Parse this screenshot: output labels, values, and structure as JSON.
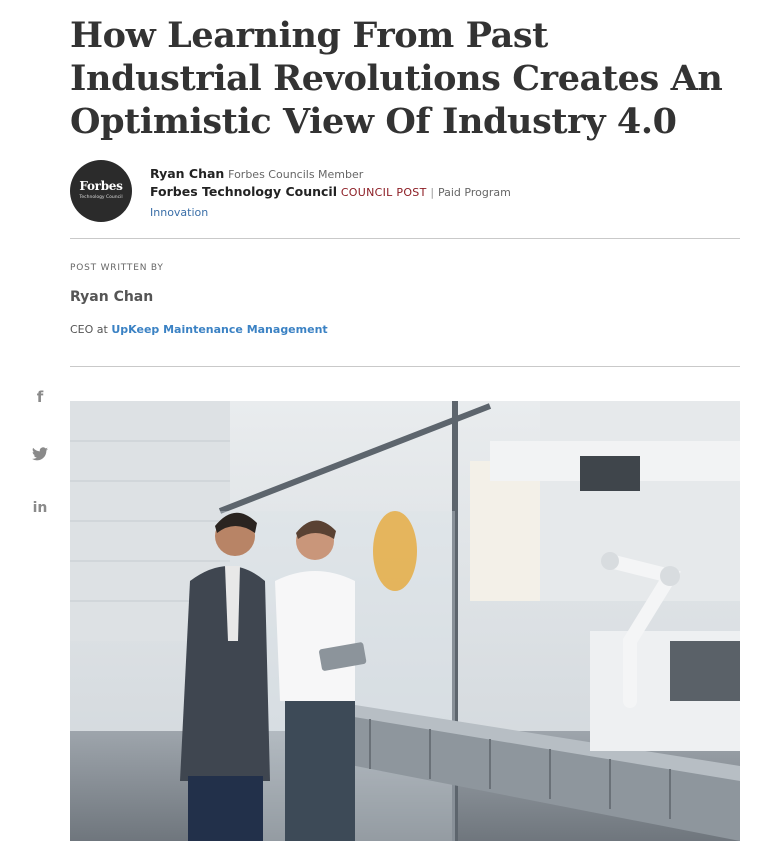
{
  "article": {
    "title": "How Learning From Past Industrial Revolutions Creates An Optimistic View Of Industry 4.0"
  },
  "byline": {
    "logo_text": "Forbes",
    "logo_subtext": "Technology Council",
    "author": "Ryan Chan",
    "member_label": "Forbes Councils Member",
    "council": "Forbes Technology Council",
    "post_tag": "COUNCIL POST",
    "separator": "|",
    "paid_label": "Paid Program",
    "topic": "Innovation"
  },
  "written_by": {
    "label": "POST WRITTEN BY",
    "name": "Ryan Chan",
    "role_prefix": "CEO at",
    "company": "UpKeep Maintenance Management"
  },
  "social": {
    "facebook_icon": "f",
    "twitter_icon": "twitter-bird",
    "linkedin_icon": "in"
  },
  "hero_image": {
    "subject": "two-men-with-tablet-beside-robotic-assembly-line"
  },
  "colors": {
    "post_tag": "#8c1d24",
    "link": "#3b6fa8",
    "company_link": "#3b82c4"
  }
}
